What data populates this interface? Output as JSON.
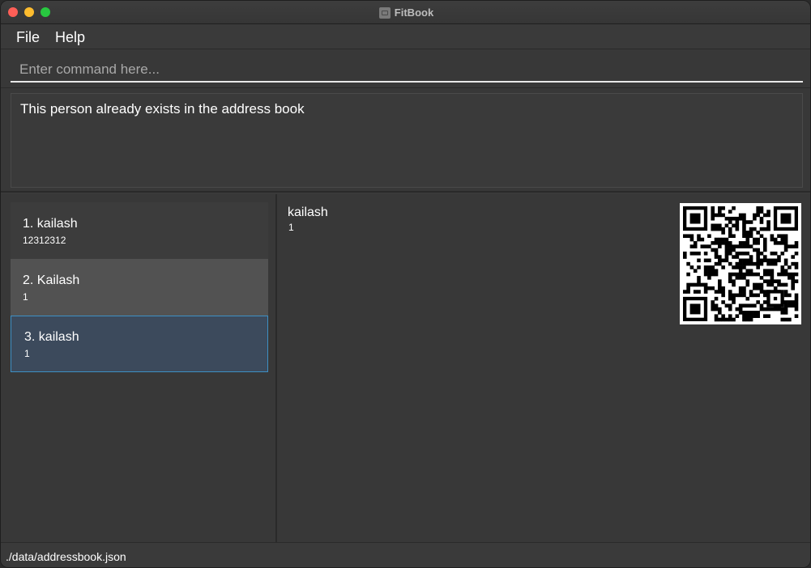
{
  "window": {
    "title": "FitBook"
  },
  "menu": {
    "items": [
      {
        "label": "File"
      },
      {
        "label": "Help"
      }
    ]
  },
  "command": {
    "placeholder": "Enter command here...",
    "value": ""
  },
  "result": {
    "message": "This person already exists in the address book"
  },
  "persons": [
    {
      "name": "1. kailash",
      "phone": "12312312",
      "state": "normal"
    },
    {
      "name": "2. Kailash",
      "phone": "1",
      "state": "hover"
    },
    {
      "name": "3. kailash",
      "phone": "1",
      "state": "selected"
    }
  ],
  "detail": {
    "name": "kailash",
    "phone": "1",
    "qr_icon": "qr-code-icon"
  },
  "status": {
    "path": "./data/addressbook.json"
  },
  "colors": {
    "background": "#383838",
    "selected_card": "#3c4a5c",
    "selected_border": "#3d8fc4",
    "hover_card": "#525252",
    "traffic_red": "#ff5f57",
    "traffic_yellow": "#febc2e",
    "traffic_green": "#28c840"
  }
}
